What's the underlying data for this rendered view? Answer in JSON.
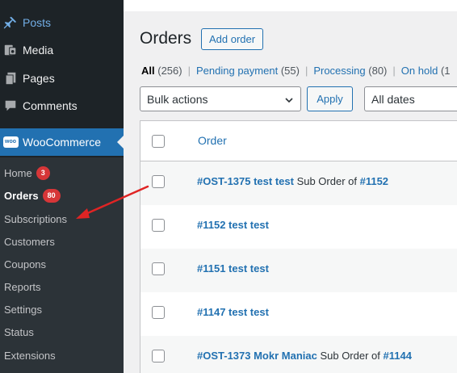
{
  "sidebar": {
    "menu": [
      {
        "label": "Posts",
        "icon": "pin-icon"
      },
      {
        "label": "Media",
        "icon": "media-icon"
      },
      {
        "label": "Pages",
        "icon": "pages-icon"
      },
      {
        "label": "Comments",
        "icon": "comments-icon"
      },
      {
        "label": "WooCommerce",
        "icon": "woo-icon"
      }
    ],
    "woo_logo_text": "woo",
    "submenu": [
      {
        "label": "Home",
        "badge": "3"
      },
      {
        "label": "Orders",
        "badge": "80"
      },
      {
        "label": "Subscriptions"
      },
      {
        "label": "Customers"
      },
      {
        "label": "Coupons"
      },
      {
        "label": "Reports"
      },
      {
        "label": "Settings"
      },
      {
        "label": "Status"
      },
      {
        "label": "Extensions"
      }
    ]
  },
  "main": {
    "title": "Orders",
    "add_order_label": "Add order",
    "filters": {
      "all": {
        "label": "All",
        "count": "(256)"
      },
      "pending": {
        "label": "Pending payment",
        "count": "(55)"
      },
      "processing": {
        "label": "Processing",
        "count": "(80)"
      },
      "on_hold": {
        "label": "On hold",
        "count": "(1"
      },
      "sep": "|"
    },
    "bulk_actions": "Bulk actions",
    "apply_label": "Apply",
    "date_filter": "All dates",
    "table": {
      "column_order": "Order",
      "rows": [
        {
          "link": "#OST-1375 test test",
          "mid": " Sub Order of ",
          "ref": "#1152"
        },
        {
          "link": "#1152 test test",
          "mid": "",
          "ref": ""
        },
        {
          "link": "#1151 test test",
          "mid": "",
          "ref": ""
        },
        {
          "link": "#1147 test test",
          "mid": "",
          "ref": ""
        },
        {
          "link": "#OST-1373 Mokr Maniac",
          "mid": " Sub Order of ",
          "ref": "#1144"
        }
      ]
    }
  },
  "colors": {
    "sidebar_bg": "#1d2327",
    "submenu_bg": "#2c3338",
    "accent": "#2271b1",
    "badge": "#d63638",
    "annotation_arrow": "#e02424"
  }
}
